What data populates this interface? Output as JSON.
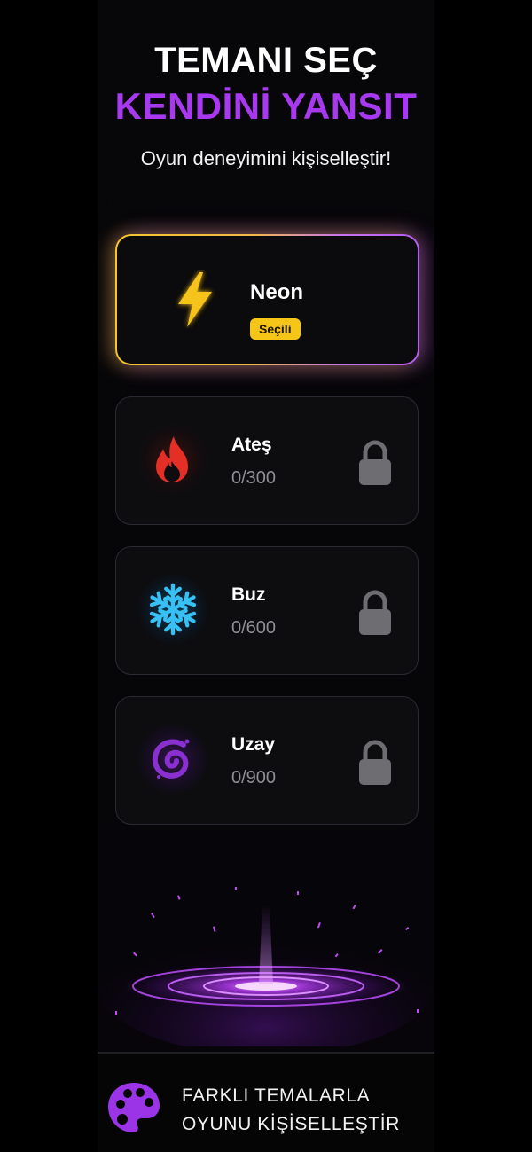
{
  "header": {
    "title_line1": "TEMANI SEÇ",
    "title_line2": "KENDİNİ YANSIT",
    "subtitle": "Oyun deneyimini kişiselleştir!"
  },
  "themes": [
    {
      "name": "Neon",
      "status": "Seçili",
      "icon": "lightning-icon",
      "selected": true
    },
    {
      "name": "Ateş",
      "progress": "0/300",
      "icon": "flame-icon",
      "locked": true
    },
    {
      "name": "Buz",
      "progress": "0/600",
      "icon": "snowflake-icon",
      "locked": true
    },
    {
      "name": "Uzay",
      "progress": "0/900",
      "icon": "galaxy-spiral-icon",
      "locked": true
    }
  ],
  "footer": {
    "line1": "FARKLI TEMALARLA",
    "line2": "OYUNU KİŞİSELLEŞTİR",
    "icon": "palette-icon"
  },
  "colors": {
    "background": "#060608",
    "accent_purple": "#a839f0",
    "badge_yellow": "#f5c518",
    "neon_yellow": "#f6c62a",
    "fire_red": "#e8312a",
    "ice_blue": "#2fb8f0",
    "space_purple": "#8a2fd0",
    "lock_gray": "#6e6e72",
    "progress_gray": "#8e8e95"
  }
}
